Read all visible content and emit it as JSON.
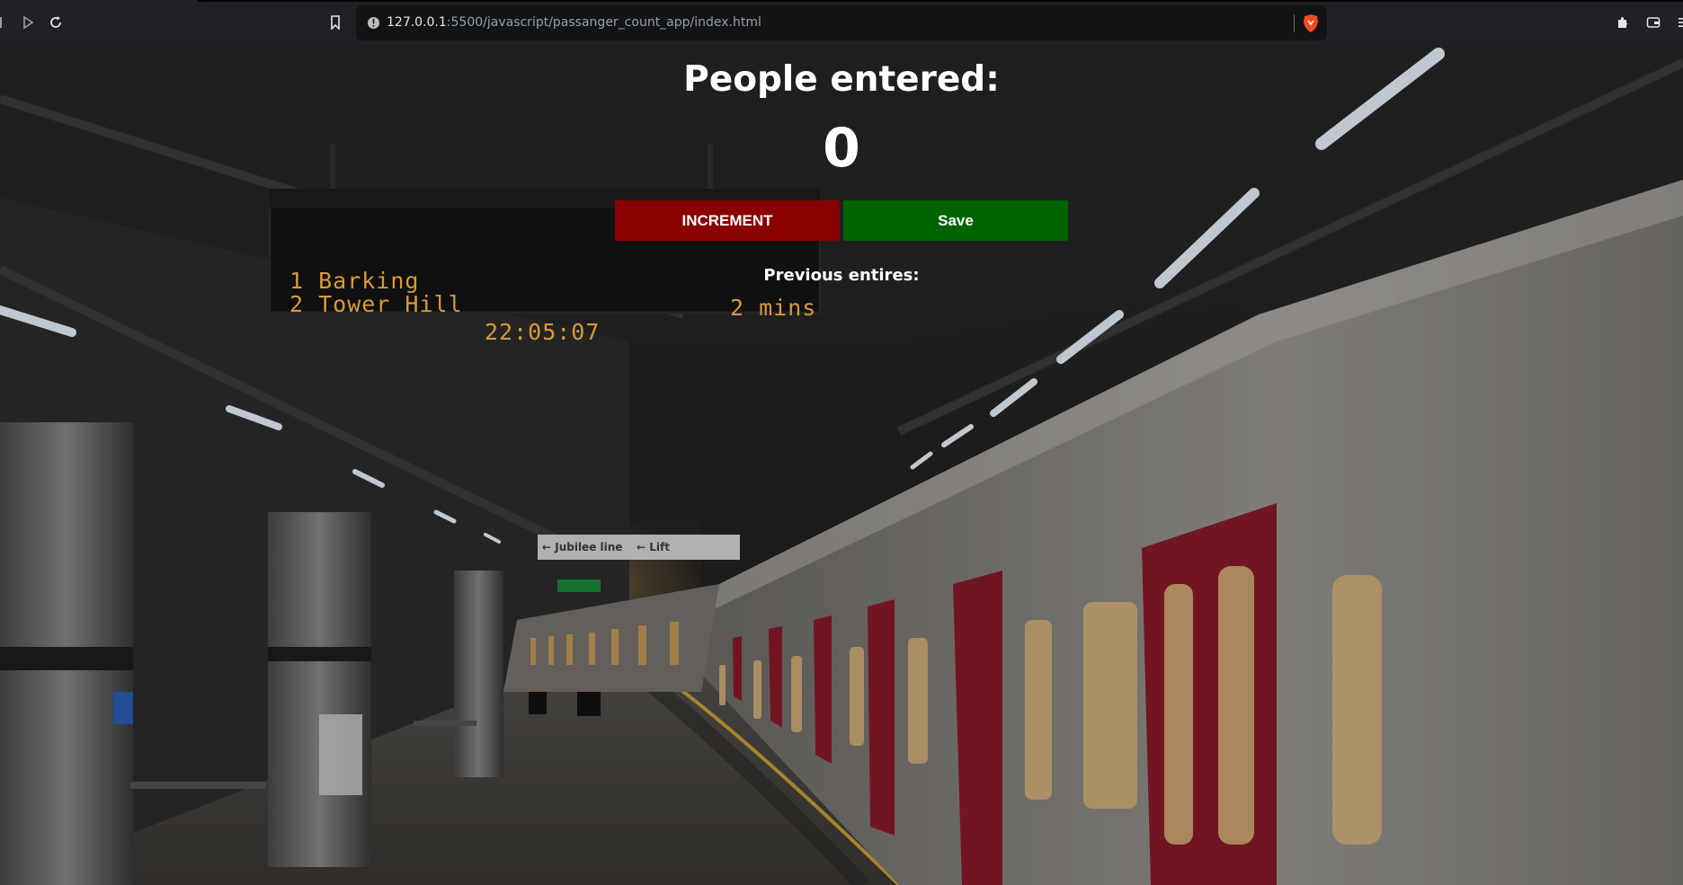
{
  "browser": {
    "url_host": "127.0.0.1",
    "url_rest": ":5500/javascript/passanger_count_app/index.html"
  },
  "app": {
    "heading": "People entered:",
    "count": "0",
    "increment_label": "INCREMENT",
    "save_label": "Save",
    "previous_label": "Previous entires:",
    "colors": {
      "increment": "#8b0000",
      "save": "#006400",
      "text": "#ffffff"
    }
  },
  "scene": {
    "board_line1": "1 Barking",
    "board_line2": "2 Tower Hill",
    "board_eta": "2 mins",
    "board_clock": "22:05:07",
    "sign_jubilee": "← Jubilee line",
    "sign_lift": "← Lift"
  }
}
